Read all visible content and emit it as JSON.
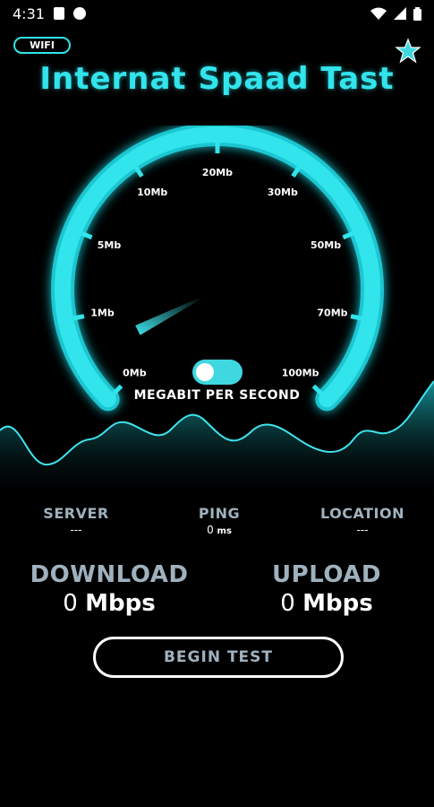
{
  "status_bar": {
    "time": "4:31"
  },
  "header": {
    "wifi_label": "WIFI",
    "title": "Internat Spaad Tast"
  },
  "gauge": {
    "tick_labels": [
      "0Mb",
      "1Mb",
      "5Mb",
      "10Mb",
      "20Mb",
      "30Mb",
      "50Mb",
      "70Mb",
      "100Mb"
    ],
    "current_speed_mb": 0,
    "unit_label": "MEGABIT PER SECOND",
    "unit_toggle_on": false
  },
  "stats": {
    "server": {
      "label": "SERVER",
      "value": "---"
    },
    "ping": {
      "label": "PING",
      "value": "0",
      "unit": "ms"
    },
    "location": {
      "label": "LOCATION",
      "value": "---"
    }
  },
  "download": {
    "label": "DOWNLOAD",
    "value": "0",
    "unit": "Mbps"
  },
  "upload": {
    "label": "UPLOAD",
    "value": "0",
    "unit": "Mbps"
  },
  "actions": {
    "begin_test_label": "BEGIN TEST"
  },
  "colors": {
    "accent": "#32e4ec",
    "label_gray": "#9fb1bd",
    "background": "#000000"
  }
}
